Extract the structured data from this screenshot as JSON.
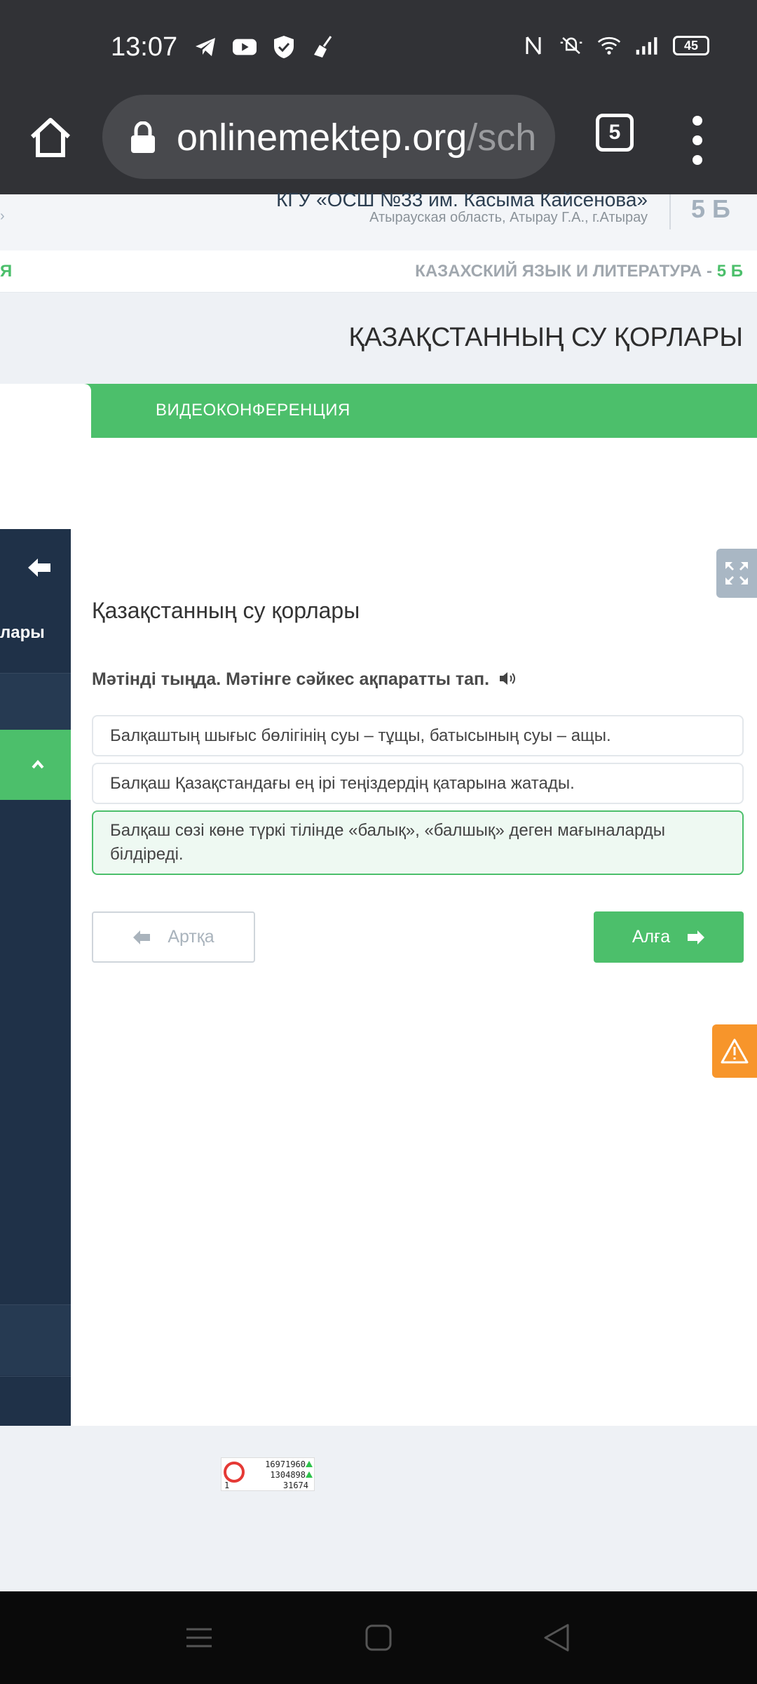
{
  "status_bar": {
    "time": "13:07",
    "battery": "45",
    "left_icons": [
      "telegram-icon",
      "youtube-icon",
      "shield-icon",
      "broom-icon"
    ],
    "right_icons": [
      "nfc-icon",
      "mute-icon",
      "wifi-icon",
      "signal-icon"
    ]
  },
  "browser": {
    "url_main": "onlinemektep.org",
    "url_rest": "/sch",
    "tab_count": "5"
  },
  "header": {
    "school_name": "КГУ «ОСШ №33 им. Касыма Кайсенова»",
    "school_region": "Атырауская область, Атырау Г.А., г.Атырау",
    "class_badge": "5 Б",
    "subject_left": "Я",
    "subject": "КАЗАХСКИЙ ЯЗЫК И ЛИТЕРАТУРА -",
    "subject_class": "5 Б"
  },
  "lesson": {
    "title": "ҚАЗАҚСТАННЫҢ СУ ҚОРЛАРЫ",
    "tab_video": "ВИДЕОКОНФЕРЕНЦИЯ"
  },
  "sidebar": {
    "label": "лары"
  },
  "task": {
    "title": "Қазақстанның су қорлары",
    "instruction": "Мәтінді тыңда. Мәтінге сәйкес ақпаратты тап.",
    "ghost": "",
    "options": [
      {
        "text": "Балқаштың шығыс бөлігінің суы – тұщы, батысының суы – ащы.",
        "selected": false
      },
      {
        "text": "Балқаш Қазақстандағы ең ірі теңіздердің қатарына жатады.",
        "selected": false
      },
      {
        "text": "Балқаш сөзі көне түркі тілінде «балық», «балшық» деген мағыналарды білдіреді.",
        "selected": true
      }
    ],
    "back_label": "Артқа",
    "next_label": "Алға"
  },
  "counter": {
    "line1": "16971960",
    "line2": "1304898",
    "line3": "31674",
    "line0": "1"
  },
  "colors": {
    "accent_green": "#4cbf6b",
    "sidebar_navy": "#1f3148",
    "warning_orange": "#f7952b"
  }
}
